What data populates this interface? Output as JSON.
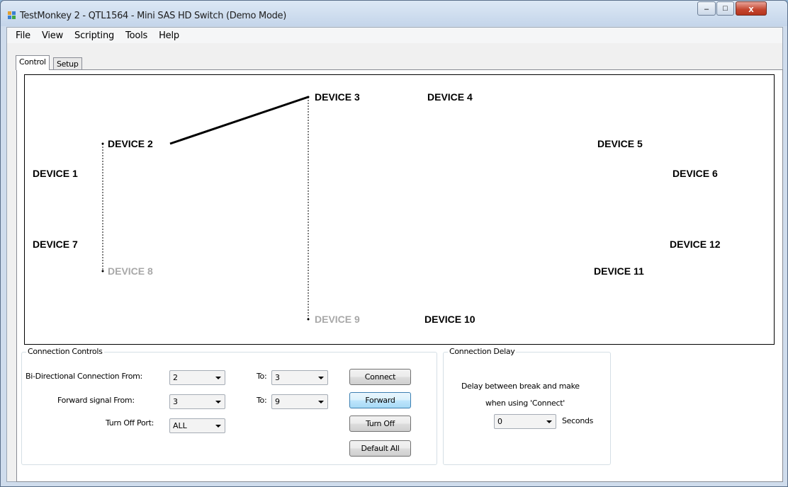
{
  "window": {
    "title": "TestMonkey 2 - QTL1564 - Mini SAS HD Switch (Demo Mode)",
    "controls": {
      "minimize": "–",
      "maximize": "□",
      "close": "x"
    }
  },
  "menu": [
    "File",
    "View",
    "Scripting",
    "Tools",
    "Help"
  ],
  "tabs": [
    {
      "label": "Control",
      "active": true
    },
    {
      "label": "Setup",
      "active": false
    }
  ],
  "devices": [
    {
      "label": "DEVICE 1",
      "dim": false
    },
    {
      "label": "DEVICE 2",
      "dim": false
    },
    {
      "label": "DEVICE 3",
      "dim": false
    },
    {
      "label": "DEVICE 4",
      "dim": false
    },
    {
      "label": "DEVICE 5",
      "dim": false
    },
    {
      "label": "DEVICE 6",
      "dim": false
    },
    {
      "label": "DEVICE 7",
      "dim": false
    },
    {
      "label": "DEVICE 8",
      "dim": true
    },
    {
      "label": "DEVICE 9",
      "dim": true
    },
    {
      "label": "DEVICE 10",
      "dim": false
    },
    {
      "label": "DEVICE 11",
      "dim": false
    },
    {
      "label": "DEVICE 12",
      "dim": false
    }
  ],
  "connections": [
    {
      "from": 2,
      "to": 3,
      "style": "solid"
    },
    {
      "from": 2,
      "to": 8,
      "style": "dashed"
    },
    {
      "from": 3,
      "to": 9,
      "style": "dashed"
    }
  ],
  "connection_controls": {
    "title": "Connection Controls",
    "bidir_label": "Bi-Directional Connection  From:",
    "bidir_from": "2",
    "bidir_to_label": "To:",
    "bidir_to": "3",
    "forward_label": "Forward signal  From:",
    "forward_from": "3",
    "forward_to_label": "To:",
    "forward_to": "9",
    "turnoff_label": "Turn Off Port:",
    "turnoff_port": "ALL",
    "connect_button": "Connect",
    "forward_button": "Forward",
    "turnoff_button": "Turn Off",
    "default_button": "Default All"
  },
  "connection_delay": {
    "title": "Connection Delay",
    "desc_line1": "Delay between break and make",
    "desc_line2": "when using 'Connect'",
    "value": "0",
    "unit": "Seconds"
  },
  "colors": {
    "dim_device": "#a8a8a8",
    "line": "#000000"
  }
}
